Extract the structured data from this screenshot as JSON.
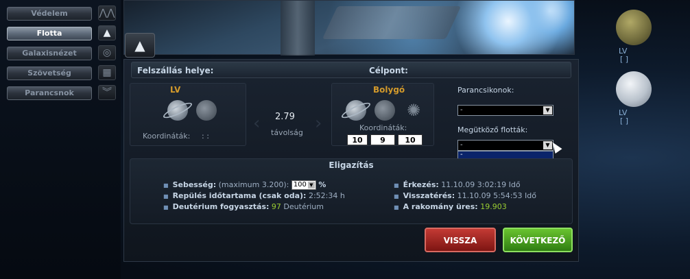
{
  "nav": {
    "items": [
      {
        "label": "Védelem",
        "icon": "defense-icon"
      },
      {
        "label": "Flotta",
        "icon": "fleet-icon",
        "active": true
      },
      {
        "label": "Galaxisnézet",
        "icon": "galaxy-icon"
      },
      {
        "label": "Szövetség",
        "icon": "alliance-icon"
      },
      {
        "label": "Parancsnok",
        "icon": "commander-icon"
      }
    ]
  },
  "header": {
    "origin_label": "Felszállás helye:",
    "target_label": "Célpont:"
  },
  "origin": {
    "name": "LV",
    "coord_label": "Koordináták:",
    "coords": ":   :"
  },
  "distance": {
    "value": "2.79",
    "label": "távolság"
  },
  "target": {
    "type": "Bolygó",
    "coord_label": "Koordináták:",
    "galaxy": "10",
    "system": "9",
    "position": "10"
  },
  "shortcuts": {
    "label": "Parancsikonok:",
    "value": "-"
  },
  "fleets": {
    "label": "Megütköző flották:",
    "value": "-",
    "list_item": "-"
  },
  "briefing": {
    "title": "Eligazítás",
    "speed_label": "Sebesség:",
    "speed_max": "(maximum 3.200):",
    "speed_value": "100",
    "speed_unit": "%",
    "duration_label": "Repülés időtartama (csak oda):",
    "duration_value": "2:52:34 h",
    "deuterium_label": "Deutérium fogyasztás:",
    "deuterium_value": "97",
    "deuterium_unit": "Deutérium",
    "arrival_label": "Érkezés:",
    "arrival_value": "11.10.09 3:02:19 Idő",
    "return_label": "Visszatérés:",
    "return_value": "11.10.09 5:54:53 Idő",
    "cargo_label": "A rakomány üres:",
    "cargo_value": "19.903"
  },
  "buttons": {
    "back": "VISSZA",
    "next": "KÖVETKEZŐ"
  },
  "planets": [
    {
      "name": "LV",
      "coords": "[          ]"
    },
    {
      "name": "LV",
      "coords": "[          ]"
    }
  ],
  "colors": {
    "accent_orange": "#d39a2b",
    "value_green": "#9acd32",
    "back_red": "#a8281f",
    "next_green": "#4aa21d"
  }
}
